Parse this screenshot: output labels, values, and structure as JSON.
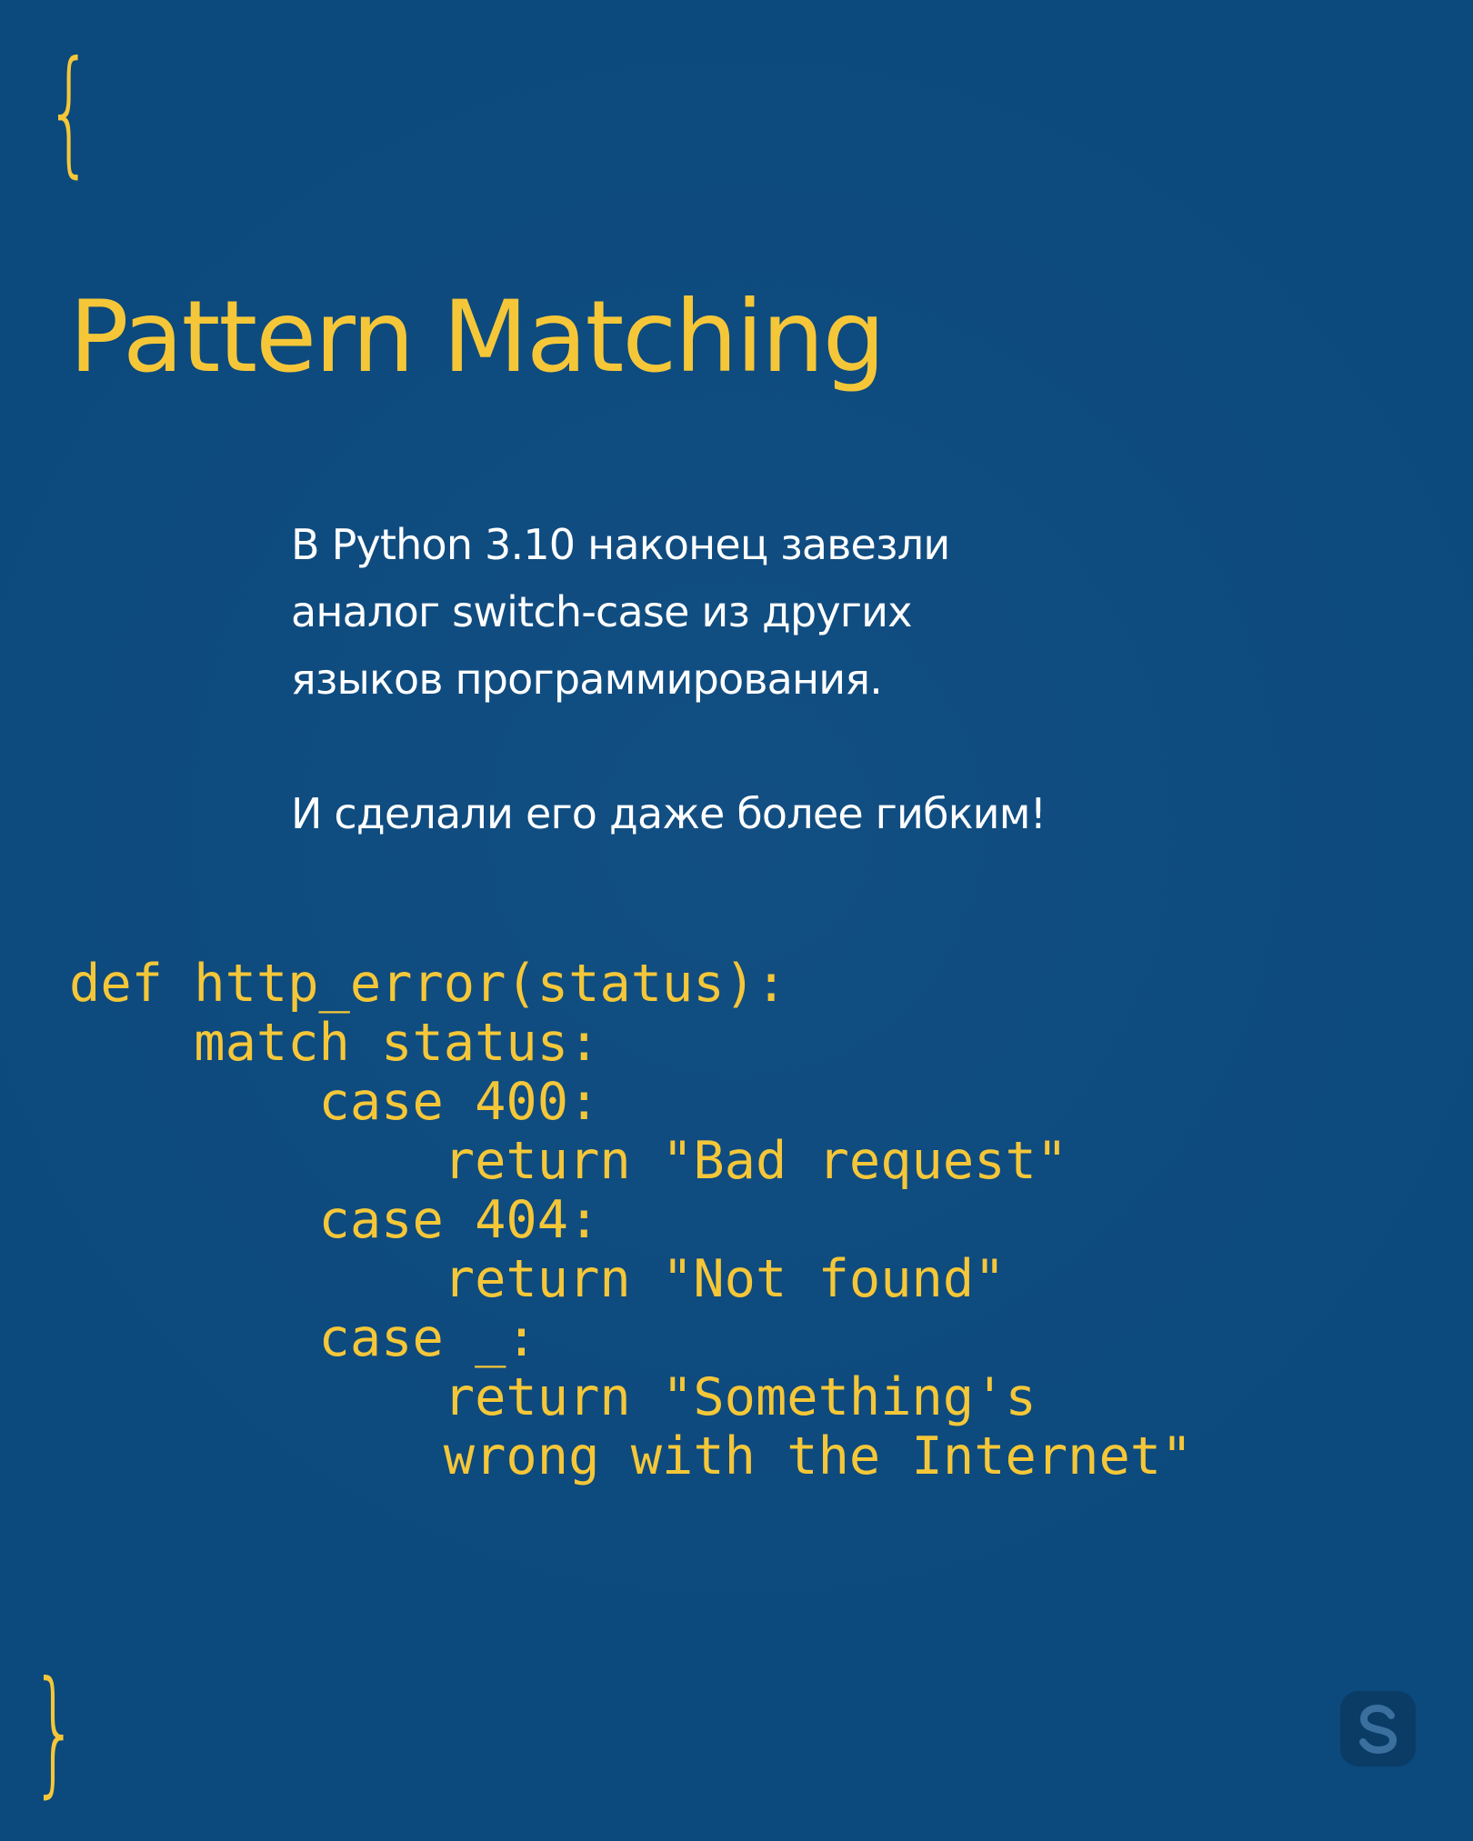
{
  "braces": {
    "open": "{",
    "close": "}"
  },
  "title": "Pattern Matching",
  "intro": {
    "lines": [
      "В Python 3.10 наконец завезли",
      "аналог switch-case из других",
      "языков программирования."
    ],
    "emphasis": "И сделали его даже более гибким!"
  },
  "code": {
    "lines": [
      "def http_error(status):",
      "    match status:",
      "        case 400:",
      "            return \"Bad request\"",
      "        case 404:",
      "            return \"Not found\"",
      "        case _:",
      "            return \"Something's",
      "            wrong with the Internet\""
    ]
  },
  "logo": {
    "icon": "s-logo-icon"
  },
  "colors": {
    "background": "#0c4a7f",
    "accent": "#f5c738",
    "text": "#ffffff",
    "logo_bg": "#0a3c66"
  }
}
